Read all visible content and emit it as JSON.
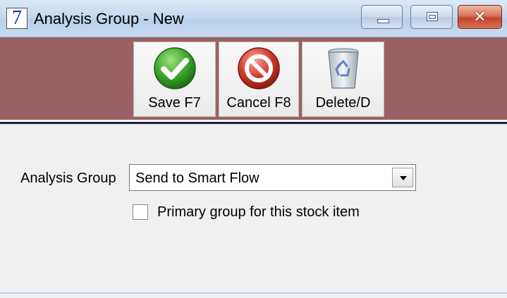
{
  "window": {
    "app_icon_glyph": "7",
    "title": "Analysis Group - New",
    "controls": {
      "minimize_icon": "minimize-icon",
      "maximize_icon": "maximize-icon",
      "close_glyph": "✕"
    }
  },
  "toolbar": {
    "band_color": "#9a6265",
    "buttons": [
      {
        "label": "Save F7",
        "icon": "check-circle-icon",
        "color": "#3aa52a"
      },
      {
        "label": "Cancel F8",
        "icon": "no-entry-icon",
        "color": "#d0392c"
      },
      {
        "label": "Delete/D",
        "icon": "recycle-bin-icon",
        "color": "#5d87b6"
      }
    ]
  },
  "form": {
    "analysis_group_label": "Analysis Group",
    "analysis_group_value": "Send to Smart Flow",
    "primary_group_label": "Primary group for this stock item",
    "primary_group_checked": false
  }
}
